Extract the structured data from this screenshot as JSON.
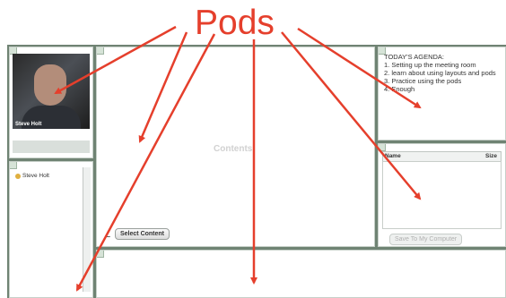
{
  "header": {
    "title": "Pods"
  },
  "camera_pod": {
    "name_tag": "Steve Holt"
  },
  "attendees_pod": {
    "attendee_name": "Steve Holt"
  },
  "share_pod": {
    "placeholder": "Contents",
    "select_button": "Select Content",
    "minus_label": "–"
  },
  "notes_pod": {
    "agenda_text": "TODAY'S AGENDA:\n1.  Setting up the meeting room\n2.  learn about using layouts and pods\n3.  Practice using the pods\n4.  Enough"
  },
  "files_pod": {
    "col_name": "Name",
    "col_size": "Size",
    "save_button": "Save To My Computer"
  },
  "colors": {
    "accent": "#e53f2c",
    "frame": "#6f8373"
  }
}
